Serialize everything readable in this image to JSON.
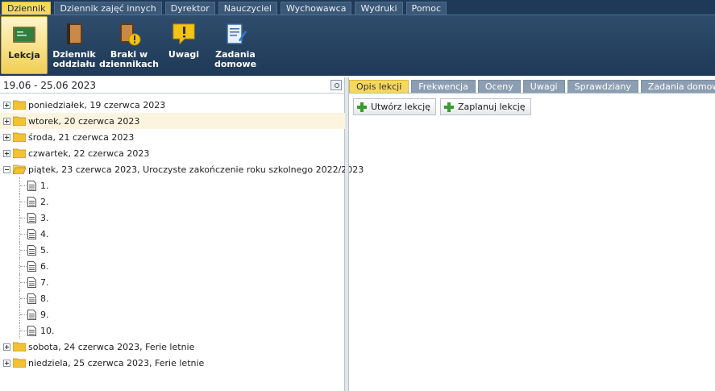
{
  "menu": {
    "tabs": [
      {
        "label": "Dziennik"
      },
      {
        "label": "Dziennik zajęć innych"
      },
      {
        "label": "Dyrektor"
      },
      {
        "label": "Nauczyciel"
      },
      {
        "label": "Wychowawca"
      },
      {
        "label": "Wydruki"
      },
      {
        "label": "Pomoc"
      }
    ],
    "active": "Dziennik"
  },
  "toolbar": {
    "buttons": [
      {
        "label": "Lekcja",
        "icon": "chalkboard-icon"
      },
      {
        "label": "Dziennik oddziału",
        "icon": "book-icon"
      },
      {
        "label": "Braki w dziennikach",
        "icon": "book-warning-icon"
      },
      {
        "label": "Uwagi",
        "icon": "warning-note-icon"
      },
      {
        "label": "Zadania domowe",
        "icon": "homework-icon"
      }
    ]
  },
  "left": {
    "date_range": "19.06 - 25.06 2023",
    "days": [
      {
        "label": "poniedziałek, 19 czerwca 2023"
      },
      {
        "label": "wtorek, 20 czerwca 2023"
      },
      {
        "label": "środa, 21 czerwca 2023"
      },
      {
        "label": "czwartek, 22 czerwca 2023"
      },
      {
        "label": "piątek, 23 czerwca 2023, Uroczyste zakończenie roku szkolnego 2022/2023"
      },
      {
        "label": "sobota, 24 czerwca 2023, Ferie letnie"
      },
      {
        "label": "niedziela, 25 czerwca 2023, Ferie letnie"
      }
    ],
    "lessons": [
      "1.",
      "2.",
      "3.",
      "4.",
      "5.",
      "6.",
      "7.",
      "8.",
      "9.",
      "10."
    ]
  },
  "right": {
    "tabs": [
      {
        "label": "Opis lekcji"
      },
      {
        "label": "Frekwencja"
      },
      {
        "label": "Oceny"
      },
      {
        "label": "Uwagi"
      },
      {
        "label": "Sprawdziany"
      },
      {
        "label": "Zadania domowe"
      }
    ],
    "buttons": {
      "create": "Utwórz lekcję",
      "plan": "Zaplanuj lekcję"
    }
  },
  "colors": {
    "accent": "#f6d85c",
    "header": "#1f3a58",
    "tab": "#8c9eb2"
  }
}
